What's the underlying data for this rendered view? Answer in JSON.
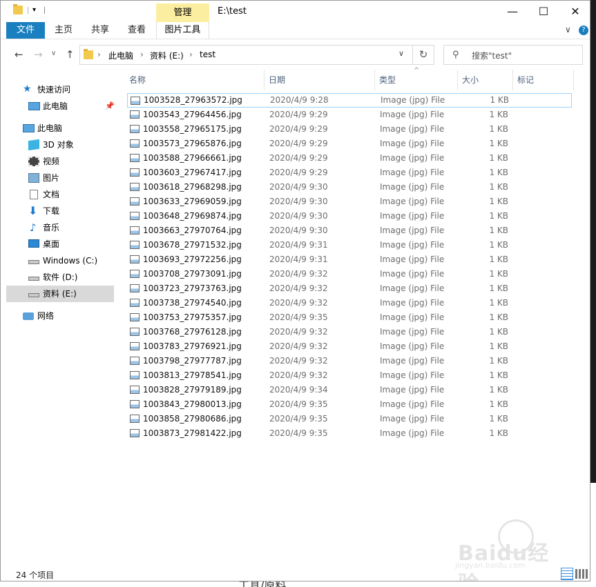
{
  "window": {
    "title": "E:\\test",
    "manage_tab": "管理",
    "controls": {
      "minimize": "—",
      "maximize": "☐",
      "close": "✕"
    }
  },
  "ribbon": {
    "tabs": [
      "文件",
      "主页",
      "共享",
      "查看"
    ],
    "picture_tools": "图片工具"
  },
  "address": {
    "crumbs": [
      "此电脑",
      "资料 (E:)",
      "test"
    ],
    "search_placeholder": "搜索\"test\""
  },
  "sidebar": {
    "items": [
      {
        "label": "快速访问",
        "icon": "star-icon"
      },
      {
        "label": "此电脑",
        "icon": "computer-icon"
      },
      {
        "label": "此电脑",
        "icon": "computer-icon"
      },
      {
        "label": "3D 对象",
        "icon": "cube-icon"
      },
      {
        "label": "视频",
        "icon": "film-icon"
      },
      {
        "label": "图片",
        "icon": "picture-icon"
      },
      {
        "label": "文档",
        "icon": "document-icon"
      },
      {
        "label": "下载",
        "icon": "download-icon"
      },
      {
        "label": "音乐",
        "icon": "music-icon"
      },
      {
        "label": "桌面",
        "icon": "desktop-icon"
      },
      {
        "label": "Windows (C:)",
        "icon": "drive-icon"
      },
      {
        "label": "软件 (D:)",
        "icon": "drive-icon"
      },
      {
        "label": "资料 (E:)",
        "icon": "drive-icon"
      },
      {
        "label": "网络",
        "icon": "network-icon"
      }
    ]
  },
  "columns": {
    "name": "名称",
    "date": "日期",
    "type": "类型",
    "size": "大小",
    "tags": "标记"
  },
  "files": [
    {
      "name": "1003528_27963572.jpg",
      "date": "2020/4/9 9:28",
      "type": "Image (jpg) File",
      "size": "1 KB"
    },
    {
      "name": "1003543_27964456.jpg",
      "date": "2020/4/9 9:29",
      "type": "Image (jpg) File",
      "size": "1 KB"
    },
    {
      "name": "1003558_27965175.jpg",
      "date": "2020/4/9 9:29",
      "type": "Image (jpg) File",
      "size": "1 KB"
    },
    {
      "name": "1003573_27965876.jpg",
      "date": "2020/4/9 9:29",
      "type": "Image (jpg) File",
      "size": "1 KB"
    },
    {
      "name": "1003588_27966661.jpg",
      "date": "2020/4/9 9:29",
      "type": "Image (jpg) File",
      "size": "1 KB"
    },
    {
      "name": "1003603_27967417.jpg",
      "date": "2020/4/9 9:29",
      "type": "Image (jpg) File",
      "size": "1 KB"
    },
    {
      "name": "1003618_27968298.jpg",
      "date": "2020/4/9 9:30",
      "type": "Image (jpg) File",
      "size": "1 KB"
    },
    {
      "name": "1003633_27969059.jpg",
      "date": "2020/4/9 9:30",
      "type": "Image (jpg) File",
      "size": "1 KB"
    },
    {
      "name": "1003648_27969874.jpg",
      "date": "2020/4/9 9:30",
      "type": "Image (jpg) File",
      "size": "1 KB"
    },
    {
      "name": "1003663_27970764.jpg",
      "date": "2020/4/9 9:30",
      "type": "Image (jpg) File",
      "size": "1 KB"
    },
    {
      "name": "1003678_27971532.jpg",
      "date": "2020/4/9 9:31",
      "type": "Image (jpg) File",
      "size": "1 KB"
    },
    {
      "name": "1003693_27972256.jpg",
      "date": "2020/4/9 9:31",
      "type": "Image (jpg) File",
      "size": "1 KB"
    },
    {
      "name": "1003708_27973091.jpg",
      "date": "2020/4/9 9:32",
      "type": "Image (jpg) File",
      "size": "1 KB"
    },
    {
      "name": "1003723_27973763.jpg",
      "date": "2020/4/9 9:32",
      "type": "Image (jpg) File",
      "size": "1 KB"
    },
    {
      "name": "1003738_27974540.jpg",
      "date": "2020/4/9 9:32",
      "type": "Image (jpg) File",
      "size": "1 KB"
    },
    {
      "name": "1003753_27975357.jpg",
      "date": "2020/4/9 9:35",
      "type": "Image (jpg) File",
      "size": "1 KB"
    },
    {
      "name": "1003768_27976128.jpg",
      "date": "2020/4/9 9:32",
      "type": "Image (jpg) File",
      "size": "1 KB"
    },
    {
      "name": "1003783_27976921.jpg",
      "date": "2020/4/9 9:32",
      "type": "Image (jpg) File",
      "size": "1 KB"
    },
    {
      "name": "1003798_27977787.jpg",
      "date": "2020/4/9 9:32",
      "type": "Image (jpg) File",
      "size": "1 KB"
    },
    {
      "name": "1003813_27978541.jpg",
      "date": "2020/4/9 9:32",
      "type": "Image (jpg) File",
      "size": "1 KB"
    },
    {
      "name": "1003828_27979189.jpg",
      "date": "2020/4/9 9:34",
      "type": "Image (jpg) File",
      "size": "1 KB"
    },
    {
      "name": "1003843_27980013.jpg",
      "date": "2020/4/9 9:35",
      "type": "Image (jpg) File",
      "size": "1 KB"
    },
    {
      "name": "1003858_27980686.jpg",
      "date": "2020/4/9 9:35",
      "type": "Image (jpg) File",
      "size": "1 KB"
    },
    {
      "name": "1003873_27981422.jpg",
      "date": "2020/4/9 9:35",
      "type": "Image (jpg) File",
      "size": "1 KB"
    }
  ],
  "status": {
    "count": "24 个项目"
  },
  "watermark": {
    "brand": "Baidu经验",
    "url": "jingyan.baidu.com"
  },
  "background_text": "工具/原料",
  "colors": {
    "accent": "#1a7fbf",
    "manage_tab": "#fbeea0",
    "selection": "#99d1ff"
  }
}
